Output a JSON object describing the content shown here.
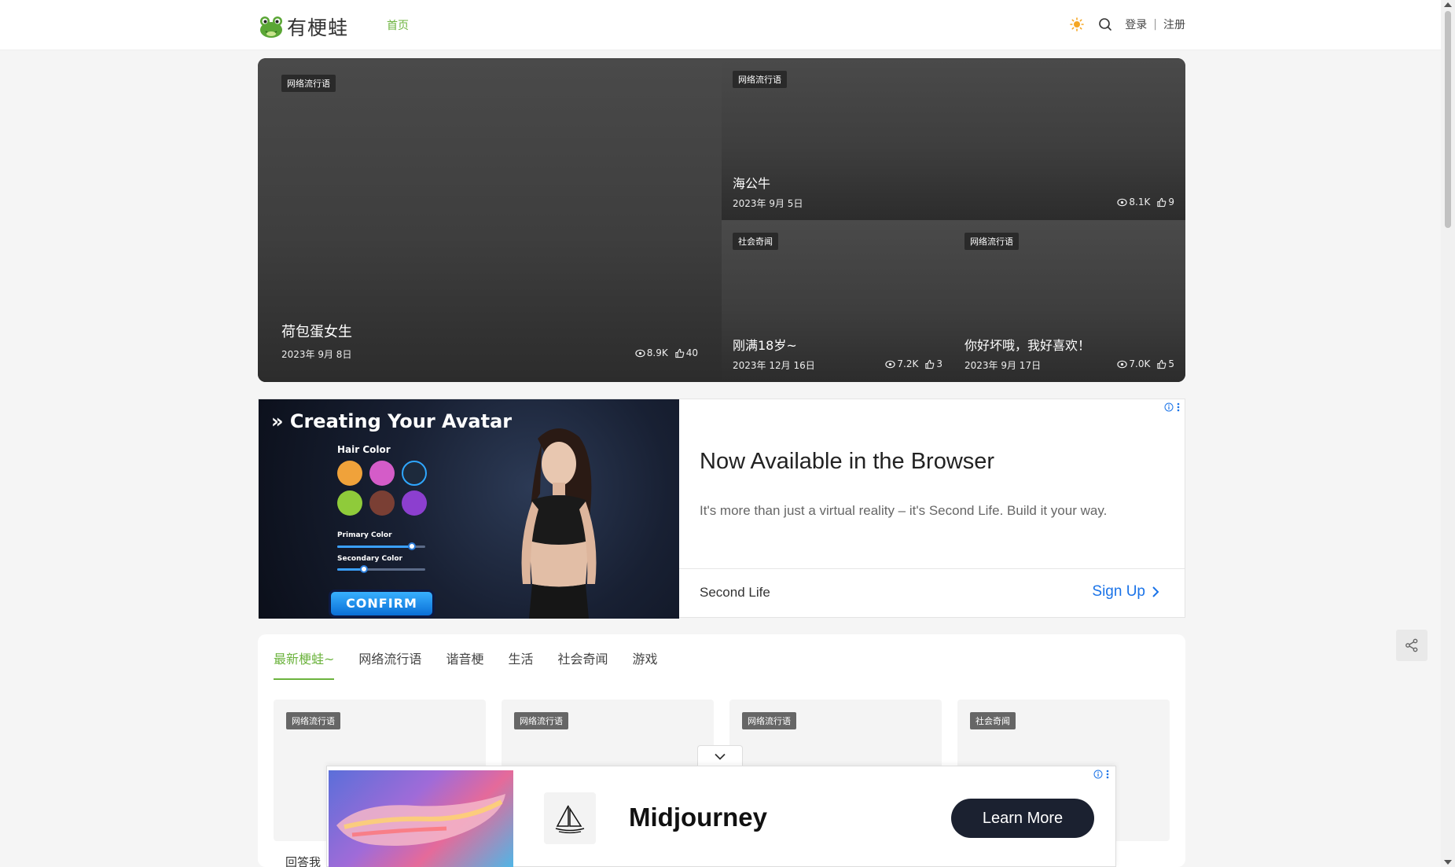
{
  "header": {
    "logo_text": "有梗蛙",
    "nav_home": "首页",
    "login": "登录",
    "separator": "|",
    "register": "注册"
  },
  "hero": {
    "cards": [
      {
        "badge": "网络流行语",
        "title": "荷包蛋女生",
        "date": "2023年 9月 8日",
        "views": "8.9K",
        "likes": "40"
      },
      {
        "badge": "网络流行语",
        "title": "海公牛",
        "date": "2023年 9月 5日",
        "views": "8.1K",
        "likes": "9"
      },
      {
        "badge": "社会奇闻",
        "title": "刚满18岁~",
        "date": "2023年 12月 16日",
        "views": "7.2K",
        "likes": "3"
      },
      {
        "badge": "网络流行语",
        "title": "你好坏哦，我好喜欢！",
        "date": "2023年 9月 17日",
        "views": "7.0K",
        "likes": "5"
      }
    ]
  },
  "ad_top": {
    "image_heading": "Creating Your Avatar",
    "hair_color_label": "Hair Color",
    "primary_color_label": "Primary Color",
    "secondary_color_label": "Secondary Color",
    "primary_level": 0.85,
    "secondary_level": 0.3,
    "confirm_label": "CONFIRM",
    "swatches": [
      "#f0a23a",
      "#d45cc8",
      "#1d2a3c",
      "#8fcb3a",
      "#7a3f34",
      "#8c3fcf"
    ],
    "title": "Now Available in the Browser",
    "description": "It's more than just a virtual reality – it's Second Life. Build it your way.",
    "brand": "Second Life",
    "cta": "Sign Up"
  },
  "content": {
    "tabs": [
      "最新梗蛙~",
      "网络流行语",
      "谐音梗",
      "生活",
      "社会奇闻",
      "游戏"
    ],
    "active_tab": 0,
    "cards": [
      {
        "badge": "网络流行语"
      },
      {
        "badge": "网络流行语"
      },
      {
        "badge": "网络流行语"
      },
      {
        "badge": "社会奇闻"
      }
    ],
    "first_card_caption": "回答我"
  },
  "ad_bottom": {
    "title": "Midjourney",
    "cta": "Learn More"
  },
  "colors": {
    "accent_green": "#6cb33e",
    "sun_orange": "#f5a623",
    "ad_link_blue": "#1a73e8",
    "cta_dark": "#1b2130"
  }
}
